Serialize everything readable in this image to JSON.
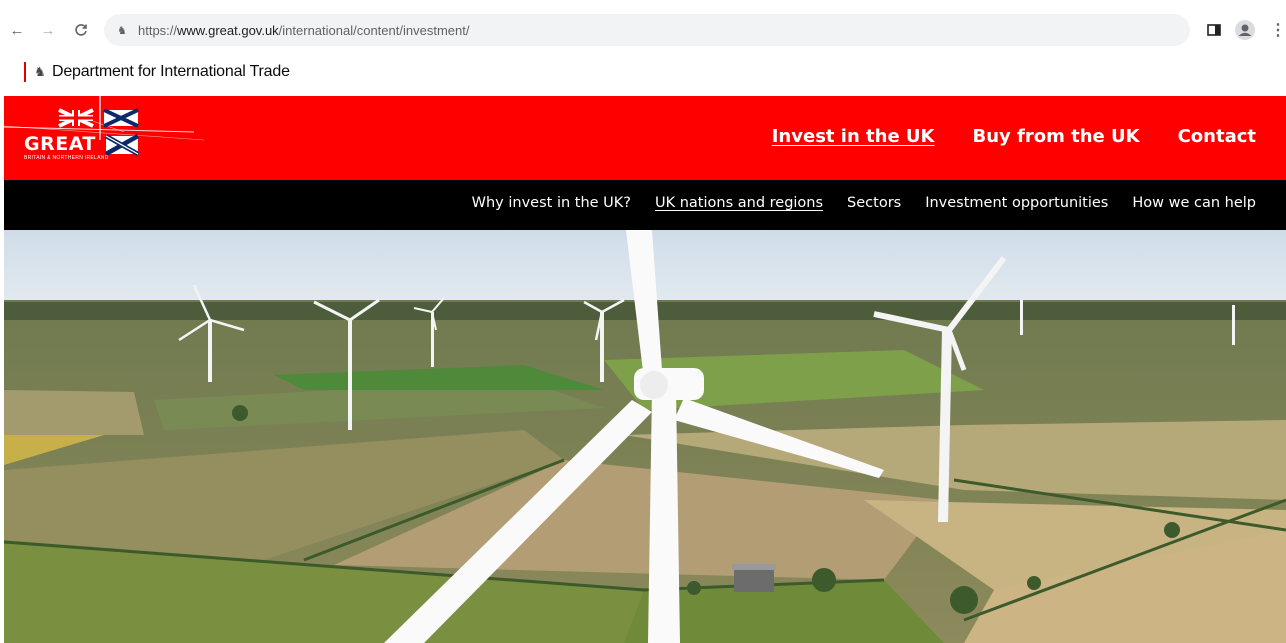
{
  "browser": {
    "url_scheme": "https://",
    "url_host": "www.great.gov.uk",
    "url_path": "/international/content/investment/",
    "back_icon": "back-arrow-icon",
    "forward_icon": "forward-arrow-icon",
    "reload_icon": "reload-icon"
  },
  "department": {
    "name": "Department for International Trade"
  },
  "header": {
    "logo_text": "GREAT",
    "logo_subtext": "BRITAIN & NORTHERN IRELAND",
    "nav": [
      {
        "label": "Invest in the UK",
        "active": true
      },
      {
        "label": "Buy from the UK",
        "active": false
      },
      {
        "label": "Contact",
        "active": false
      }
    ],
    "brand_color": "#ff0000"
  },
  "subnav": {
    "items": [
      {
        "label": "Why invest in the UK?",
        "active": false
      },
      {
        "label": "UK nations and regions",
        "active": true
      },
      {
        "label": "Sectors",
        "active": false
      },
      {
        "label": "Investment opportunities",
        "active": false
      },
      {
        "label": "How we can help",
        "active": false
      }
    ]
  },
  "hero": {
    "image": "wind-turbines-over-farmland"
  }
}
